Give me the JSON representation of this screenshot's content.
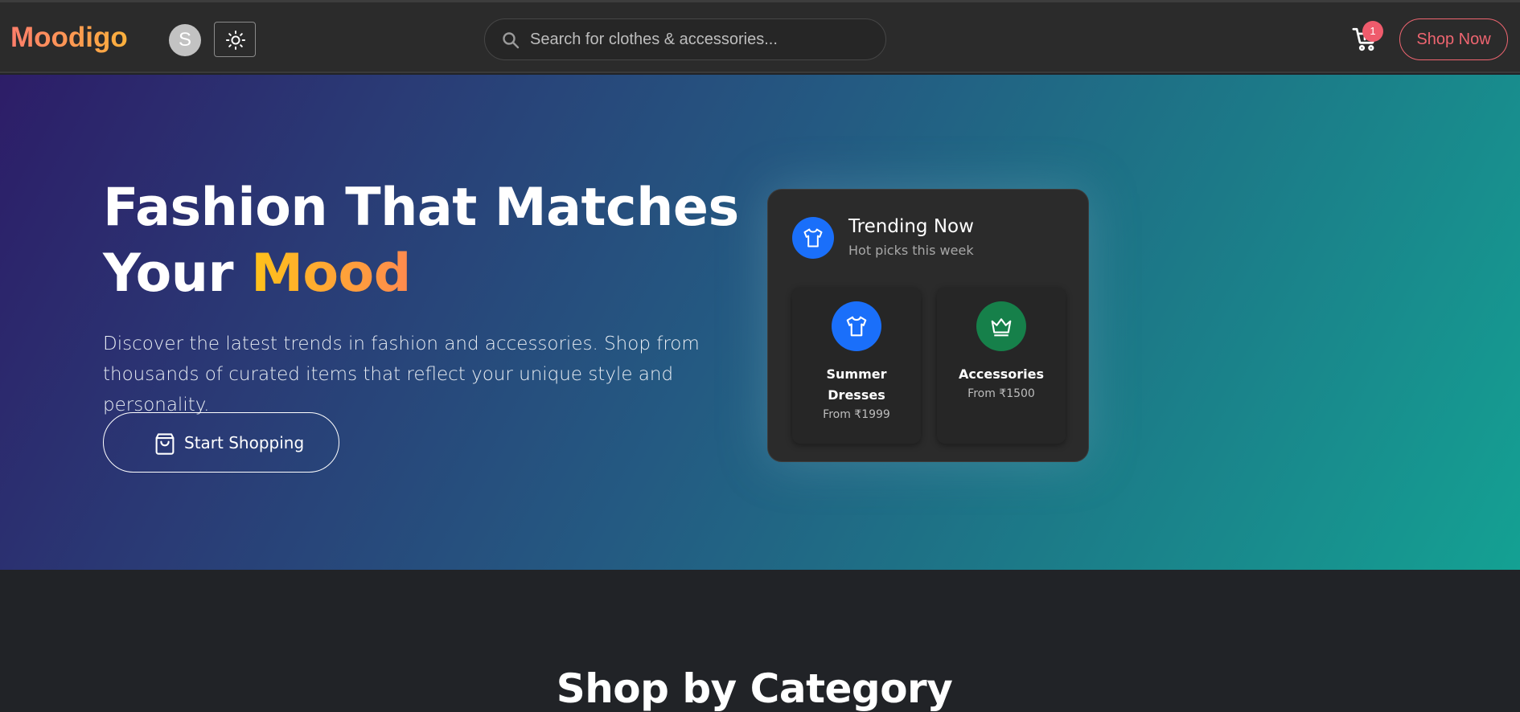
{
  "navbar": {
    "brand": "Moodigo",
    "avatar_initial": "S",
    "theme_icon": "sun-icon",
    "search": {
      "placeholder": "Search for clothes & accessories...",
      "value": ""
    },
    "cart": {
      "icon": "cart-icon",
      "count": "1"
    },
    "shop_now_label": "Shop Now"
  },
  "hero": {
    "title_line1": "Fashion That Matches",
    "title_line2_prefix": "Your ",
    "title_line2_accent": "Mood",
    "description": "Discover the latest trends in fashion and accessories. Shop from thousands of curated items that reflect your unique style and personality.",
    "cta_label": "Start Shopping",
    "cta_icon": "shopping-bag-icon"
  },
  "trending": {
    "title": "Trending Now",
    "subtitle": "Hot picks this week",
    "icon": "shirt-icon",
    "items": [
      {
        "name": "Summer Dresses",
        "price": "From ₹1999",
        "icon": "shirt-icon",
        "color": "#1a6ffa"
      },
      {
        "name": "Accessories",
        "price": "From ₹1500",
        "icon": "crown-icon",
        "color": "#16804a"
      }
    ]
  },
  "categories": {
    "title": "Shop by Category"
  },
  "colors": {
    "brand_gradient": [
      "#ff7e6b",
      "#fbb13c"
    ],
    "accent_red": "#ee6570",
    "hero_gradient": [
      "#2d1d68",
      "#14a193"
    ]
  }
}
